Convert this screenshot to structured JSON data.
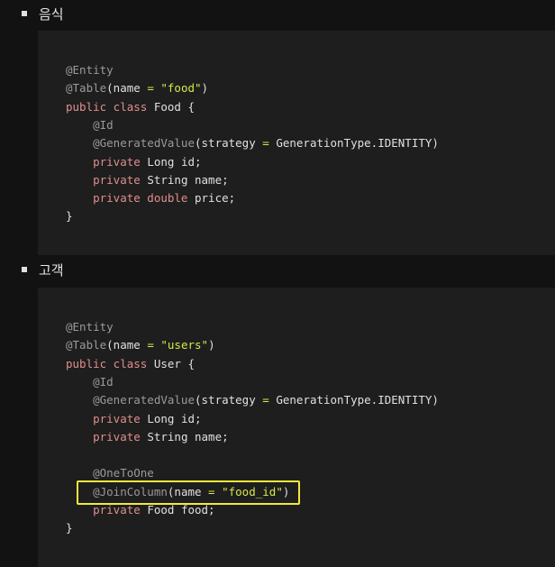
{
  "sections": [
    {
      "heading": "음식",
      "code": [
        [
          {
            "t": "@Entity",
            "c": "ann"
          }
        ],
        [
          {
            "t": "@Table",
            "c": "ann"
          },
          {
            "t": "(name ",
            "c": "plain"
          },
          {
            "t": "=",
            "c": "op"
          },
          {
            "t": " ",
            "c": "plain"
          },
          {
            "t": "\"food\"",
            "c": "str"
          },
          {
            "t": ")",
            "c": "plain"
          }
        ],
        [
          {
            "t": "public class",
            "c": "kw"
          },
          {
            "t": " Food {",
            "c": "plain"
          }
        ],
        [
          {
            "t": "    @Id",
            "c": "ann"
          }
        ],
        [
          {
            "t": "    @GeneratedValue",
            "c": "ann"
          },
          {
            "t": "(strategy ",
            "c": "plain"
          },
          {
            "t": "=",
            "c": "op"
          },
          {
            "t": " GenerationType.IDENTITY)",
            "c": "plain"
          }
        ],
        [
          {
            "t": "    private",
            "c": "kw"
          },
          {
            "t": " Long id;",
            "c": "plain"
          }
        ],
        [
          {
            "t": "    private",
            "c": "kw"
          },
          {
            "t": " String name;",
            "c": "plain"
          }
        ],
        [
          {
            "t": "    private double",
            "c": "kw"
          },
          {
            "t": " price;",
            "c": "plain"
          }
        ],
        [
          {
            "t": "}",
            "c": "plain"
          }
        ]
      ]
    },
    {
      "heading": "고객",
      "code": [
        [
          {
            "t": "@Entity",
            "c": "ann"
          }
        ],
        [
          {
            "t": "@Table",
            "c": "ann"
          },
          {
            "t": "(name ",
            "c": "plain"
          },
          {
            "t": "=",
            "c": "op"
          },
          {
            "t": " ",
            "c": "plain"
          },
          {
            "t": "\"users\"",
            "c": "str"
          },
          {
            "t": ")",
            "c": "plain"
          }
        ],
        [
          {
            "t": "public class",
            "c": "kw"
          },
          {
            "t": " User {",
            "c": "plain"
          }
        ],
        [
          {
            "t": "    @Id",
            "c": "ann"
          }
        ],
        [
          {
            "t": "    @GeneratedValue",
            "c": "ann"
          },
          {
            "t": "(strategy ",
            "c": "plain"
          },
          {
            "t": "=",
            "c": "op"
          },
          {
            "t": " GenerationType.IDENTITY)",
            "c": "plain"
          }
        ],
        [
          {
            "t": "    private",
            "c": "kw"
          },
          {
            "t": " Long id;",
            "c": "plain"
          }
        ],
        [
          {
            "t": "    private",
            "c": "kw"
          },
          {
            "t": " String name;",
            "c": "plain"
          }
        ],
        [
          {
            "t": "",
            "c": "plain"
          }
        ],
        [
          {
            "t": "    @OneToOne",
            "c": "ann"
          }
        ],
        [
          {
            "t": "    @JoinColumn",
            "c": "ann"
          },
          {
            "t": "(name ",
            "c": "plain"
          },
          {
            "t": "=",
            "c": "op"
          },
          {
            "t": " ",
            "c": "plain"
          },
          {
            "t": "\"food_id\"",
            "c": "str"
          },
          {
            "t": ")",
            "c": "plain"
          }
        ],
        [
          {
            "t": "    private",
            "c": "kw"
          },
          {
            "t": " Food food;",
            "c": "plain"
          }
        ],
        [
          {
            "t": "}",
            "c": "plain"
          }
        ]
      ]
    }
  ],
  "colors": {
    "background": "#121212",
    "code_background": "#1e1e1e",
    "annotation": "#9a9a9a",
    "keyword": "#e08e8e",
    "string": "#d6e84a",
    "highlight": "#f3e83a"
  }
}
